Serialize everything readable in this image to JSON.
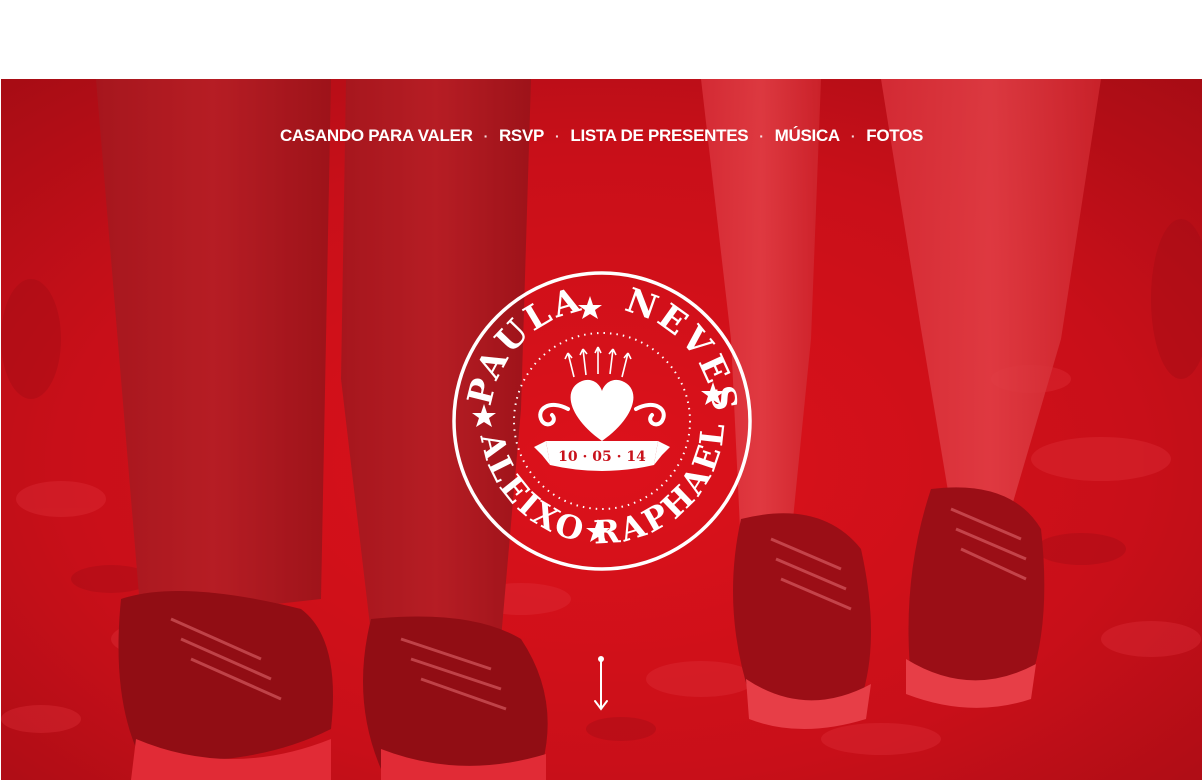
{
  "nav": {
    "items": [
      {
        "label": "CASANDO PARA VALER"
      },
      {
        "label": "RSVP"
      },
      {
        "label": "LISTA DE PRESENTES"
      },
      {
        "label": "MÚSICA"
      },
      {
        "label": "FOTOS"
      }
    ],
    "separator": "·"
  },
  "emblem": {
    "top_text_left": "PAULA",
    "top_text_right": "NEVES",
    "bottom_text_left": "ALEIXO",
    "bottom_text_right": "RAPHAEL",
    "date": "10 · 05 · 14"
  },
  "colors": {
    "hero_red": "#c8121b",
    "dark_red": "#7a0a10",
    "white": "#ffffff"
  },
  "icons": {
    "scroll": "arrow-down-icon",
    "heart": "heart-icon",
    "star": "star-icon"
  }
}
